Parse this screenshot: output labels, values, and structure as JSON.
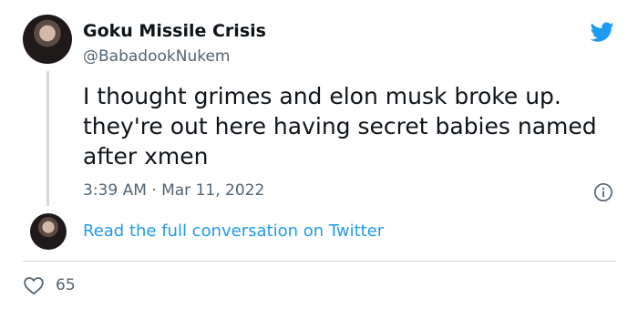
{
  "tweet": {
    "author_name": "Goku Missile Crisis",
    "author_handle": "@BabadookNukem",
    "text": "I thought grimes and elon musk broke up.\nthey're out here having secret babies named\nafter xmen",
    "timestamp": "3:39 AM · Mar 11, 2022",
    "read_link": "Read the full conversation on Twitter",
    "like_count": "65"
  },
  "icons": {
    "brand": "twitter-bird-icon",
    "info": "info-icon",
    "like": "heart-icon"
  },
  "colors": {
    "accent": "#1d9bf0",
    "secondary_text": "#536471",
    "primary_text": "#0f1419",
    "divider": "#cfd9de"
  }
}
